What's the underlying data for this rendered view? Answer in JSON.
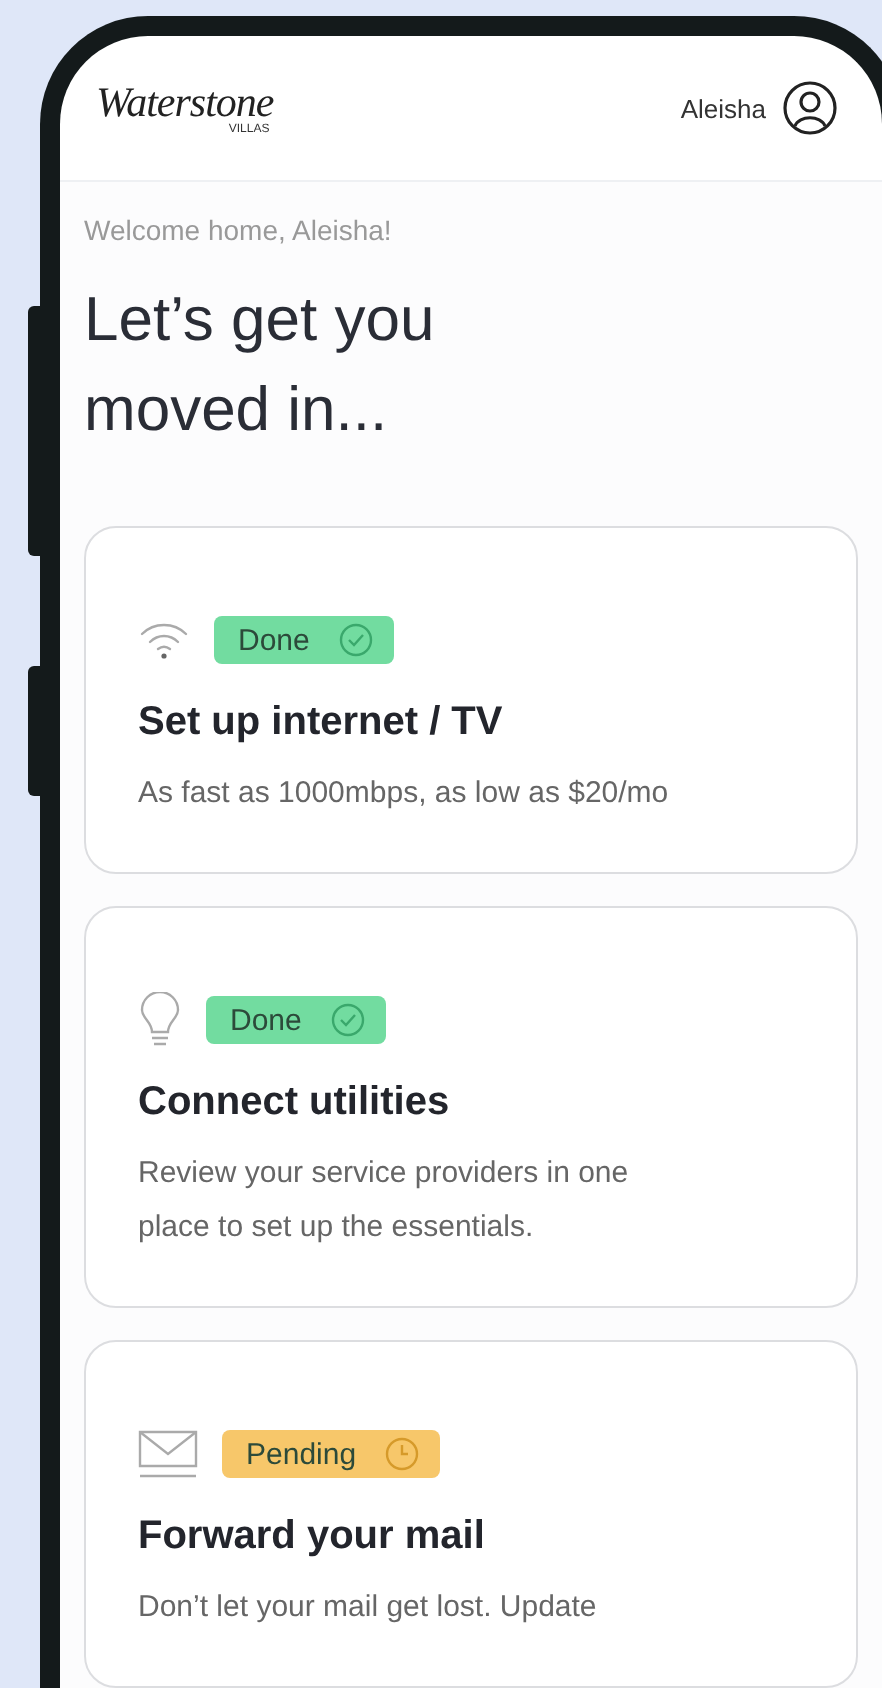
{
  "header": {
    "logo": {
      "name": "Waterstone",
      "sub": "VILLAS"
    },
    "user_name": "Aleisha"
  },
  "welcome": "Welcome home, Aleisha!",
  "heading": "Let’s get you moved in...",
  "tasks": [
    {
      "kind": "wifi",
      "badge": {
        "kind": "done",
        "label": "Done",
        "color": "#72dca0"
      },
      "title": "Set up internet / TV",
      "description": "As fast as 1000mbps, as low as $20/mo"
    },
    {
      "kind": "bulb",
      "badge": {
        "kind": "done",
        "label": "Done",
        "color": "#72dca0"
      },
      "title": "Connect utilities",
      "description": "Review your service providers in one place to set up the essentials."
    },
    {
      "kind": "mail",
      "badge": {
        "kind": "pending",
        "label": "Pending",
        "color": "#f7c76a"
      },
      "title": "Forward your mail",
      "description": "Don’t let your mail get lost. Update"
    }
  ]
}
